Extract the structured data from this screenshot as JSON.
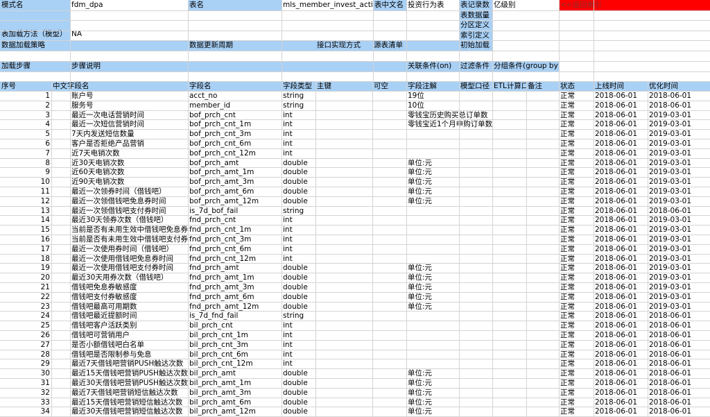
{
  "meta": {
    "mode_label": "模式名",
    "mode_value": "fdm_dpa",
    "table_label": "表名",
    "table_value": "mls_member_invest_action",
    "cn_name_label": "表中文名",
    "cn_name_value": "投资行为表",
    "record_count_label": "表记录数",
    "record_unit_label": "亿级别",
    "return_link": "<<返回索引",
    "data_volume_label": "表数据量",
    "partition_label": "分区定义",
    "index_label": "索引定义",
    "load_method_label": "表加载方法（模型）",
    "load_method_value": "NA",
    "load_strategy_label": "数据加载策略",
    "update_cycle_label": "数据更新周期",
    "interface_label": "接口实现方式",
    "source_label": "源表清单",
    "init_load_label": "初始加载",
    "load_step_label": "加载步骤",
    "step_desc_label": "步骤说明",
    "join_label": "关联条件(on)",
    "filter_label": "过滤条件",
    "group_label": "分组条件(group by)"
  },
  "columns": [
    "序号",
    "中文字段名",
    "字段名",
    "字段类型",
    "主键",
    "可空",
    "字段注解",
    "模型口径",
    "ETL计算口",
    "备注",
    "状态",
    "上线时间",
    "优化时间"
  ],
  "rows": [
    {
      "no": "1",
      "cn": "账户号",
      "field": "acct_no",
      "type": "string",
      "note": "19位",
      "status": "正常",
      "online": "2018-06-01",
      "opt": "2018-06-01"
    },
    {
      "no": "2",
      "cn": "服务号",
      "field": "member_id",
      "type": "string",
      "note": "10位",
      "status": "正常",
      "online": "2018-06-01",
      "opt": "2018-06-01"
    },
    {
      "no": "3",
      "cn": "最近一次电话营销时间",
      "field": "bof_prch_cnt",
      "type": "int",
      "note": "零钱宝历史购买总订单数",
      "status": "正常",
      "online": "2018-06-01",
      "opt": "2019-03-01"
    },
    {
      "no": "4",
      "cn": "最近一次短信营销时间",
      "field": "bof_prch_cnt_1m",
      "type": "int",
      "note": "零钱宝近1个月申购订单数",
      "status": "正常",
      "online": "2018-06-01",
      "opt": "2019-03-01"
    },
    {
      "no": "5",
      "cn": "7天内发送短信数量",
      "field": "bof_prch_cnt_3m",
      "type": "int",
      "note": "",
      "status": "正常",
      "online": "2018-06-01",
      "opt": "2019-03-01"
    },
    {
      "no": "6",
      "cn": "客户是否拒绝产品营销",
      "field": "bof_prch_cnt_6m",
      "type": "int",
      "note": "",
      "status": "正常",
      "online": "2018-06-01",
      "opt": "2019-03-01"
    },
    {
      "no": "7",
      "cn": "近7天电销次数",
      "field": "bof_prch_cnt_12m",
      "type": "int",
      "note": "",
      "status": "正常",
      "online": "2018-06-01",
      "opt": "2019-03-01"
    },
    {
      "no": "8",
      "cn": "近30天电销次数",
      "field": "bof_prch_amt",
      "type": "double",
      "note": "单位:元",
      "status": "正常",
      "online": "2018-06-01",
      "opt": "2019-03-01"
    },
    {
      "no": "9",
      "cn": "近60天电销次数",
      "field": "bof_prch_amt_1m",
      "type": "double",
      "note": "单位:元",
      "status": "正常",
      "online": "2018-06-01",
      "opt": "2019-03-01"
    },
    {
      "no": "10",
      "cn": "近90天电销次数",
      "field": "bof_prch_amt_3m",
      "type": "double",
      "note": "单位:元",
      "status": "正常",
      "online": "2018-06-01",
      "opt": "2019-03-01"
    },
    {
      "no": "11",
      "cn": "最近一次领券时间（借钱吧）",
      "field": "bof_prch_amt_6m",
      "type": "double",
      "note": "单位:元",
      "status": "正常",
      "online": "2018-06-01",
      "opt": "2019-03-01"
    },
    {
      "no": "12",
      "cn": "最近一次领借钱吧免息券时间",
      "field": "bof_prch_amt_12m",
      "type": "double",
      "note": "单位:元",
      "status": "正常",
      "online": "2018-06-01",
      "opt": "2019-03-01"
    },
    {
      "no": "13",
      "cn": "最近一次领借钱吧支付券时间",
      "field": "is_7d_bof_fail",
      "type": "string",
      "note": "",
      "status": "正常",
      "online": "2018-06-01",
      "opt": "2018-06-01"
    },
    {
      "no": "14",
      "cn": "最近30天领券次数（借钱吧）",
      "field": "fnd_prch_cnt",
      "type": "int",
      "note": "",
      "status": "正常",
      "online": "2018-06-01",
      "opt": "2019-03-01"
    },
    {
      "no": "15",
      "cn": "当前是否有未用生效中借钱吧免息券",
      "field": "fnd_prch_cnt_1m",
      "type": "int",
      "note": "",
      "status": "正常",
      "online": "2018-06-01",
      "opt": "2019-03-01"
    },
    {
      "no": "16",
      "cn": "当前是否有未用生效中借钱吧支付券",
      "field": "fnd_prch_cnt_3m",
      "type": "int",
      "note": "",
      "status": "正常",
      "online": "2018-06-01",
      "opt": "2019-03-01"
    },
    {
      "no": "17",
      "cn": "最近一次使用券时间（借钱吧）",
      "field": "fnd_prch_cnt_6m",
      "type": "int",
      "note": "",
      "status": "正常",
      "online": "2018-06-01",
      "opt": "2019-03-01"
    },
    {
      "no": "18",
      "cn": "最近一次使用借钱吧免息券时间",
      "field": "fnd_prch_cnt_12m",
      "type": "int",
      "note": "",
      "status": "正常",
      "online": "2018-06-01",
      "opt": "2019-03-01"
    },
    {
      "no": "19",
      "cn": "最近一次使用借钱吧支付券时间",
      "field": "fnd_prch_amt",
      "type": "double",
      "note": "单位:元",
      "status": "正常",
      "online": "2018-06-01",
      "opt": "2019-03-01"
    },
    {
      "no": "20",
      "cn": "最近30天用券次数（借钱吧）",
      "field": "fnd_prch_amt_1m",
      "type": "double",
      "note": "单位:元",
      "status": "正常",
      "online": "2018-06-01",
      "opt": "2019-03-01"
    },
    {
      "no": "21",
      "cn": "借钱吧免息券敏感度",
      "field": "fnd_prch_amt_3m",
      "type": "double",
      "note": "单位:元",
      "status": "正常",
      "online": "2018-06-01",
      "opt": "2019-03-01"
    },
    {
      "no": "22",
      "cn": "借钱吧支付券敏感度",
      "field": "fnd_prch_amt_6m",
      "type": "double",
      "note": "单位:元",
      "status": "正常",
      "online": "2018-06-01",
      "opt": "2019-03-01"
    },
    {
      "no": "23",
      "cn": "借钱吧最高可用期数",
      "field": "fnd_prch_amt_12m",
      "type": "double",
      "note": "单位:元",
      "status": "正常",
      "online": "2018-06-01",
      "opt": "2019-03-01"
    },
    {
      "no": "24",
      "cn": "借钱吧最近提额时间",
      "field": "is_7d_fnd_fail",
      "type": "string",
      "note": "",
      "status": "正常",
      "online": "2018-06-01",
      "opt": "2018-06-01"
    },
    {
      "no": "25",
      "cn": "借钱吧客户活跃类别",
      "field": "bil_prch_cnt",
      "type": "int",
      "note": "",
      "status": "正常",
      "online": "2018-06-01",
      "opt": "2018-06-01"
    },
    {
      "no": "26",
      "cn": "借钱吧可营销用户",
      "field": "bil_prch_cnt_1m",
      "type": "int",
      "note": "",
      "status": "正常",
      "online": "2018-06-01",
      "opt": "2018-06-01"
    },
    {
      "no": "27",
      "cn": "是否小额借钱吧白名单",
      "field": "bil_prch_cnt_3m",
      "type": "int",
      "note": "",
      "status": "正常",
      "online": "2018-06-01",
      "opt": "2018-06-01"
    },
    {
      "no": "28",
      "cn": "借钱吧是否限制参与免息",
      "field": "bil_prch_cnt_6m",
      "type": "int",
      "note": "",
      "status": "正常",
      "online": "2018-06-01",
      "opt": "2018-06-01"
    },
    {
      "no": "29",
      "cn": "最近7天借钱吧营销PUSH触达次数",
      "field": "bil_prch_cnt_12m",
      "type": "int",
      "note": "",
      "status": "正常",
      "online": "2018-06-01",
      "opt": "2018-06-01"
    },
    {
      "no": "30",
      "cn": "最近15天借钱吧营销PUSH触达次数",
      "field": "bil_prch_amt",
      "type": "double",
      "note": "单位:元",
      "status": "正常",
      "online": "2018-06-01",
      "opt": "2018-06-01"
    },
    {
      "no": "31",
      "cn": "最近30天借钱吧营销PUSH触达次数",
      "field": "bil_prch_amt_1m",
      "type": "double",
      "note": "单位:元",
      "status": "正常",
      "online": "2018-06-01",
      "opt": "2018-06-01"
    },
    {
      "no": "32",
      "cn": "最近7天借钱吧营销短信触达次数",
      "field": "bil_prch_amt_3m",
      "type": "double",
      "note": "单位:元",
      "status": "正常",
      "online": "2018-06-01",
      "opt": "2018-06-01"
    },
    {
      "no": "33",
      "cn": "最近15天借钱吧营销短信触达次数",
      "field": "bil_prch_amt_6m",
      "type": "double",
      "note": "单位:元",
      "status": "正常",
      "online": "2018-06-01",
      "opt": "2018-06-01"
    },
    {
      "no": "34",
      "cn": "最近30天借钱吧营销短信触达次数",
      "field": "bil_prch_amt_12m",
      "type": "double",
      "note": "单位:元",
      "status": "正常",
      "online": "2018-06-01",
      "opt": "2018-06-01"
    }
  ]
}
